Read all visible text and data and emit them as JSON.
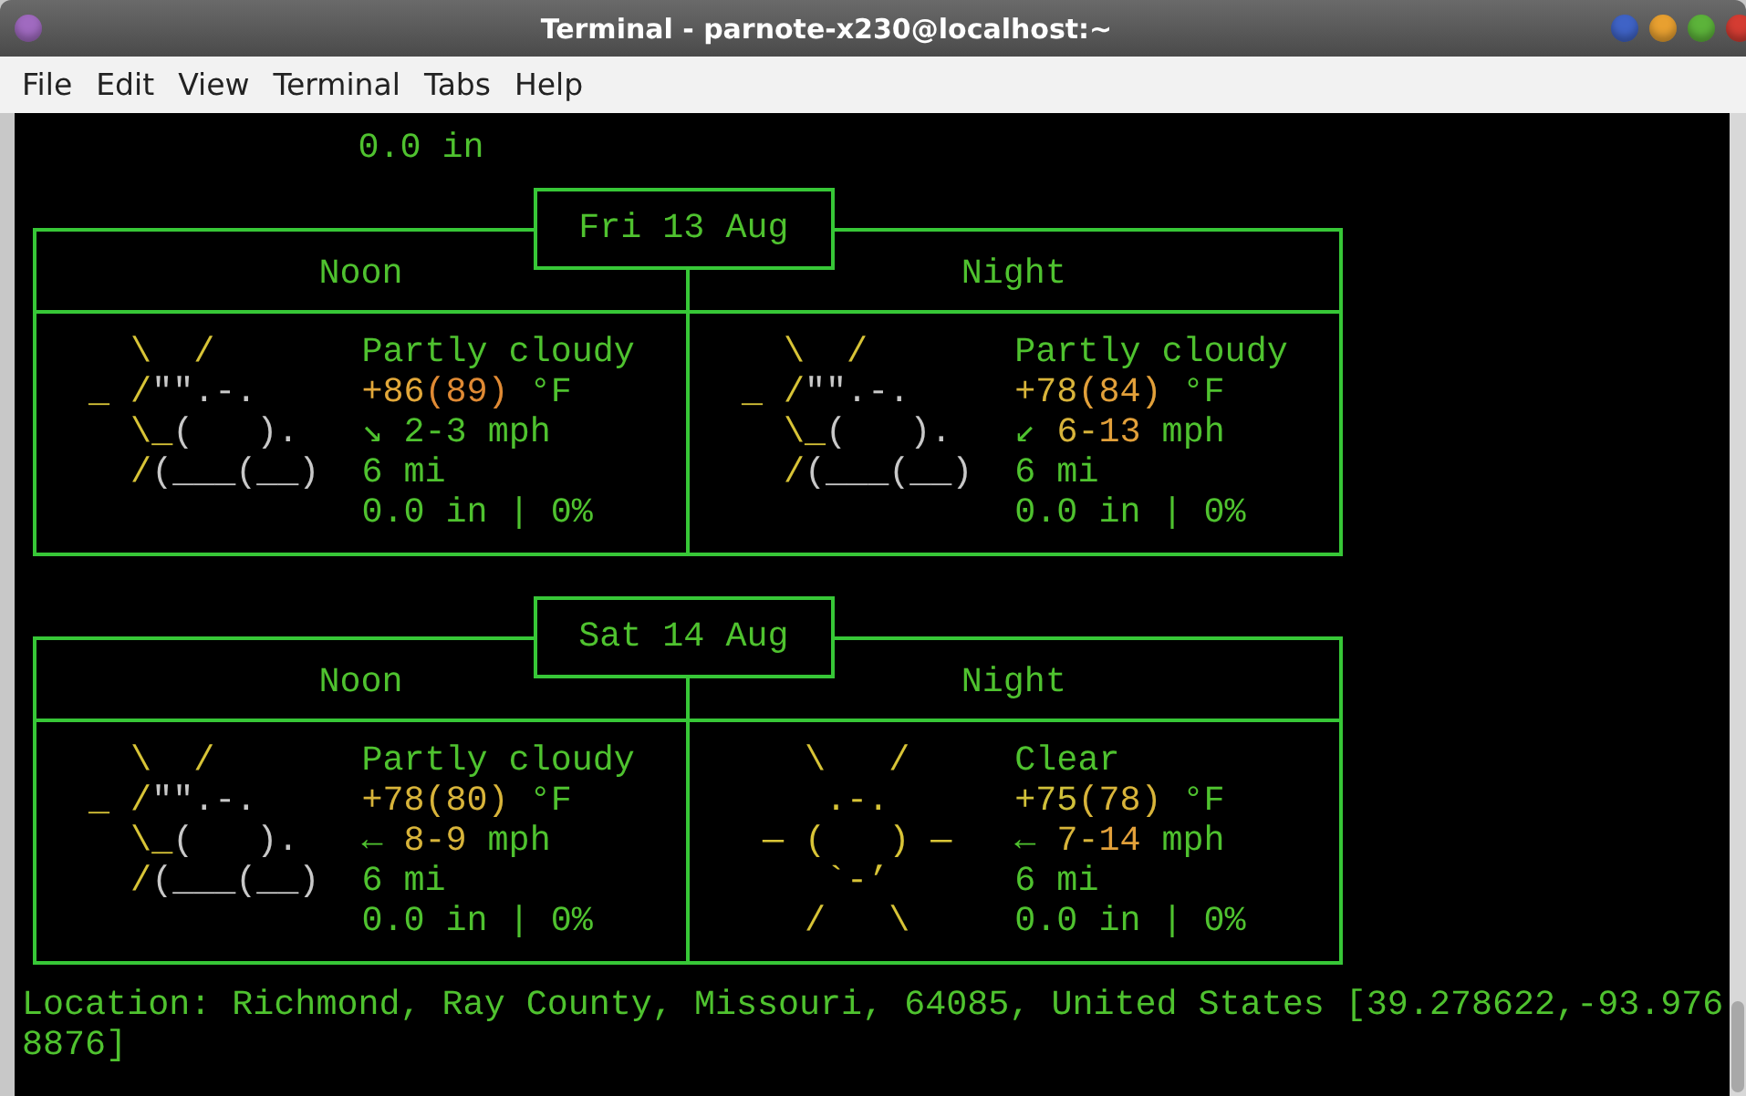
{
  "window": {
    "title": "Terminal - parnote-x230@localhost:~"
  },
  "menu": [
    "File",
    "Edit",
    "View",
    "Terminal",
    "Tabs",
    "Help"
  ],
  "leading_line": "0.0 in",
  "days": [
    {
      "date": "Fri 13 Aug",
      "periods": [
        {
          "name": "Noon",
          "art": [
            [
              {
                "text": "    \\  /",
                "color": "#d8c437"
              }
            ],
            [
              {
                "text": "  _ /",
                "color": "#d8c437"
              },
              {
                "text": "\"\".-.",
                "color": "#c8c8c8"
              }
            ],
            [
              {
                "text": "    \\_",
                "color": "#d8c437"
              },
              {
                "text": "(   ).",
                "color": "#c8c8c8"
              }
            ],
            [
              {
                "text": "    /",
                "color": "#d8c437"
              },
              {
                "text": "(___(__)",
                "color": "#c8c8c8"
              }
            ]
          ],
          "condition": "Partly cloudy",
          "temperature": [
            {
              "text": "+86",
              "color": "#e2a83a"
            },
            {
              "text": "(89)",
              "color": "#e08a34"
            },
            {
              "text": " °F",
              "color": "#4fc22f"
            }
          ],
          "wind": [
            {
              "text": "↘ 2-3 mph",
              "color": "#4fc22f"
            }
          ],
          "visibility": "6 mi",
          "precipitation": "0.0 in | 0%"
        },
        {
          "name": "Night",
          "art": [
            [
              {
                "text": "    \\  /",
                "color": "#d8c437"
              }
            ],
            [
              {
                "text": "  _ /",
                "color": "#d8c437"
              },
              {
                "text": "\"\".-.",
                "color": "#c8c8c8"
              }
            ],
            [
              {
                "text": "    \\_",
                "color": "#d8c437"
              },
              {
                "text": "(   ).",
                "color": "#c8c8c8"
              }
            ],
            [
              {
                "text": "    /",
                "color": "#d8c437"
              },
              {
                "text": "(___(__)",
                "color": "#c8c8c8"
              }
            ]
          ],
          "condition": "Partly cloudy",
          "temperature": [
            {
              "text": "+78",
              "color": "#d8b43a"
            },
            {
              "text": "(84)",
              "color": "#e2a03a"
            },
            {
              "text": " °F",
              "color": "#4fc22f"
            }
          ],
          "wind": [
            {
              "text": "↙ ",
              "color": "#4fc22f"
            },
            {
              "text": "6-",
              "color": "#d8b43a"
            },
            {
              "text": "13",
              "color": "#e2a03a"
            },
            {
              "text": " mph",
              "color": "#4fc22f"
            }
          ],
          "visibility": "6 mi",
          "precipitation": "0.0 in | 0%"
        }
      ]
    },
    {
      "date": "Sat 14 Aug",
      "periods": [
        {
          "name": "Noon",
          "art": [
            [
              {
                "text": "    \\  /",
                "color": "#d8c437"
              }
            ],
            [
              {
                "text": "  _ /",
                "color": "#d8c437"
              },
              {
                "text": "\"\".-.",
                "color": "#c8c8c8"
              }
            ],
            [
              {
                "text": "    \\_",
                "color": "#d8c437"
              },
              {
                "text": "(   ).",
                "color": "#c8c8c8"
              }
            ],
            [
              {
                "text": "    /",
                "color": "#d8c437"
              },
              {
                "text": "(___(__)",
                "color": "#c8c8c8"
              }
            ]
          ],
          "condition": "Partly cloudy",
          "temperature": [
            {
              "text": "+78(80)",
              "color": "#d8b43a"
            },
            {
              "text": " °F",
              "color": "#4fc22f"
            }
          ],
          "wind": [
            {
              "text": "← ",
              "color": "#4fc22f"
            },
            {
              "text": "8-9",
              "color": "#d8b43a"
            },
            {
              "text": " mph",
              "color": "#4fc22f"
            }
          ],
          "visibility": "6 mi",
          "precipitation": "0.0 in | 0%"
        },
        {
          "name": "Night",
          "art": [
            [
              {
                "text": "     \\   /",
                "color": "#d8c437"
              }
            ],
            [
              {
                "text": "      .-.",
                "color": "#d8c437"
              }
            ],
            [
              {
                "text": "   ― (   ) ―",
                "color": "#d8c437"
              }
            ],
            [
              {
                "text": "      `-’",
                "color": "#d8c437"
              }
            ],
            [
              {
                "text": "     /   \\",
                "color": "#d8c437"
              }
            ]
          ],
          "condition": "Clear",
          "temperature": [
            {
              "text": "+75",
              "color": "#d0c03a"
            },
            {
              "text": "(78)",
              "color": "#d8b43a"
            },
            {
              "text": " °F",
              "color": "#4fc22f"
            }
          ],
          "wind": [
            {
              "text": "← ",
              "color": "#4fc22f"
            },
            {
              "text": "7-",
              "color": "#d8b43a"
            },
            {
              "text": "14",
              "color": "#e2a03a"
            },
            {
              "text": " mph",
              "color": "#4fc22f"
            }
          ],
          "visibility": "6 mi",
          "precipitation": "0.0 in | 0%"
        }
      ]
    }
  ],
  "location": "Location: Richmond, Ray County, Missouri, 64085, United States [39.278622,-93.9768876]"
}
